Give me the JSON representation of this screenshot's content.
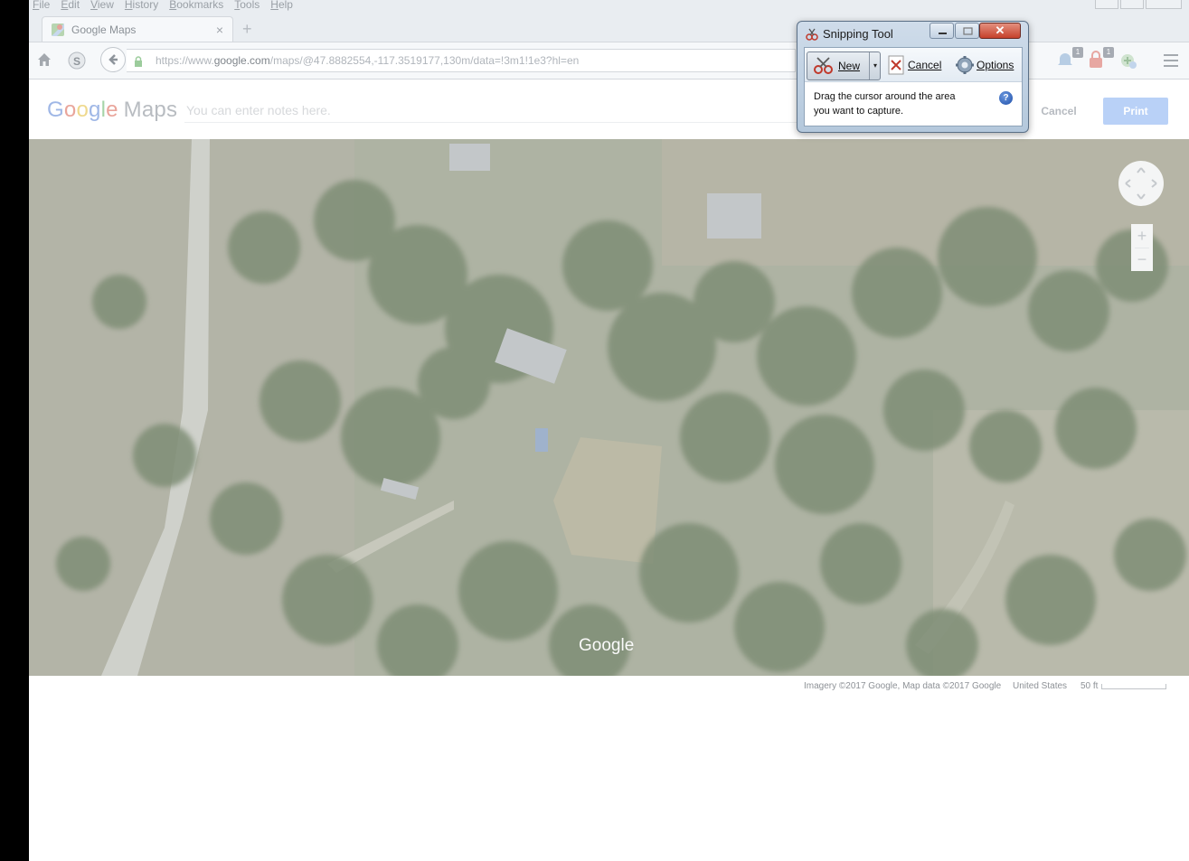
{
  "browser": {
    "menu": [
      "File",
      "Edit",
      "View",
      "History",
      "Bookmarks",
      "Tools",
      "Help"
    ],
    "tab_title": "Google Maps",
    "tab_close": "×",
    "new_tab": "+",
    "url_prefix": "https://www.",
    "url_domain": "google.com",
    "url_rest": "/maps/@47.8882554,-117.3519177,130m/data=!3m1!1e3?hl=en",
    "badges": [
      "1",
      "1"
    ]
  },
  "print_page": {
    "logo_letters": [
      "G",
      "o",
      "o",
      "g",
      "l",
      "e"
    ],
    "logo_maps": "Maps",
    "notes_placeholder": "You can enter notes here.",
    "cancel_label": "Cancel",
    "print_label": "Print"
  },
  "map": {
    "watermark": "Google",
    "zoom_in": "+",
    "zoom_out": "−",
    "imagery_credit": "Imagery ©2017 Google, Map data ©2017 Google",
    "country": "United States",
    "scale_label": "50 ft"
  },
  "snipping_tool": {
    "title": "Snipping Tool",
    "close": "✕",
    "new_label": "New",
    "dropdown_arrow": "▾",
    "cancel_label": "Cancel",
    "options_label": "Options",
    "message_line1": "Drag the cursor around the area",
    "message_line2": "you want to capture.",
    "help": "?"
  }
}
